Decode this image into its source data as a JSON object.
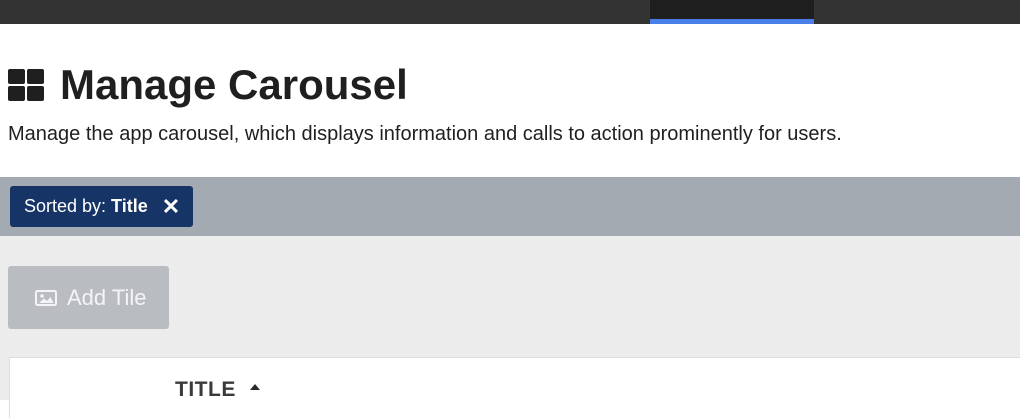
{
  "header": {
    "title": "Manage Carousel",
    "title_icon": "grid-icon",
    "description": "Manage the app carousel, which displays information and calls to action prominently for users."
  },
  "filter": {
    "sorted_by_label": "Sorted by:",
    "sorted_by_value": "Title",
    "clear_icon": "close-icon"
  },
  "toolbar": {
    "add_tile_label": "Add Tile",
    "add_tile_icon": "image-icon"
  },
  "table": {
    "columns": [
      {
        "label": "TITLE",
        "sort": "ascending"
      }
    ]
  },
  "colors": {
    "topbar": "#333333",
    "active_tab_indicator": "#4a7fe8",
    "sort_chip": "#163465",
    "filter_bar": "#a4aab1",
    "button_disabled": "#b9bdc2"
  }
}
